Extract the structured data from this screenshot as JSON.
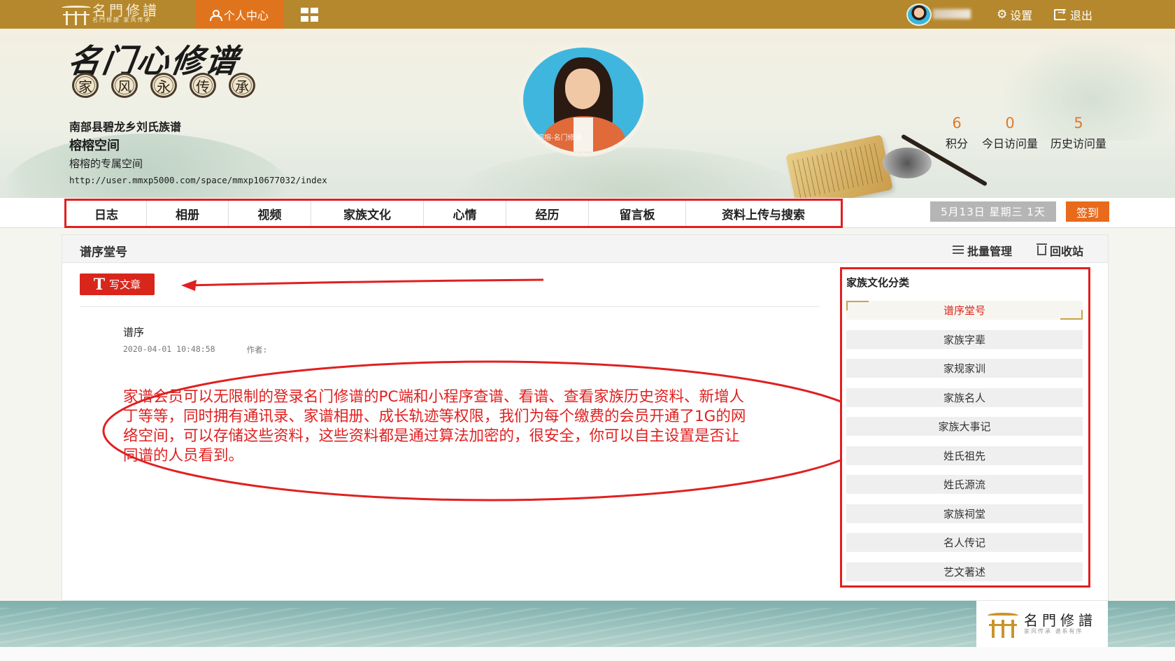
{
  "topbar": {
    "logo_text": "名門修譜",
    "logo_sub": "名門修譜 家风传承",
    "personal_center": "个人中心",
    "settings": "设置",
    "logout": "退出"
  },
  "banner": {
    "brand_title": "名门心修谱",
    "motto": [
      "家",
      "风",
      "永",
      "传",
      "承"
    ],
    "clan_name": "南部县碧龙乡刘氏族谱",
    "space_title": "榕榕空间",
    "space_subtitle": "榕榕的专属空间",
    "space_url": "http://user.mmxp5000.com/space/mmxp10677032/index",
    "photo_watermark": "榕榕-名门修谱",
    "stats": [
      {
        "value": "6",
        "label": "积分"
      },
      {
        "value": "0",
        "label": "今日访问量"
      },
      {
        "value": "5",
        "label": "历史访问量"
      }
    ]
  },
  "tabs": [
    "日志",
    "相册",
    "视频",
    "家族文化",
    "心情",
    "经历",
    "留言板",
    "资料上传与搜索"
  ],
  "date_badge": "5月13日  星期三  1天",
  "signin_label": "签到",
  "panel": {
    "title": "谱序堂号",
    "batch_manage": "批量管理",
    "recycle_bin": "回收站",
    "write_article": "写文章"
  },
  "article": {
    "title": "谱序",
    "date": "2020-04-01 10:48:58",
    "author_label": "作者:"
  },
  "annotation": {
    "text": "家谱会员可以无限制的登录名门修谱的PC端和小程序查谱、看谱、查看家族历史资料、新增人丁等等，同时拥有通讯录、家谱相册、成长轨迹等权限，我们为每个缴费的会员开通了1G的网络空间，可以存储这些资料，这些资料都是通过算法加密的，很安全，你可以自主设置是否让同谱的人员看到。"
  },
  "categories": {
    "title": "家族文化分类",
    "items": [
      "谱序堂号",
      "家族字辈",
      "家规家训",
      "家族名人",
      "家族大事记",
      "姓氏祖先",
      "姓氏源流",
      "家族祠堂",
      "名人传记",
      "艺文著述"
    ]
  },
  "footer": {
    "logo_text": "名門修譜",
    "logo_sub": "家风传承  谱系有序"
  },
  "colors": {
    "topbar": "#b5882d",
    "accent_orange": "#e0741d",
    "annotation_red": "#e02020",
    "write_button": "#d9261c"
  }
}
